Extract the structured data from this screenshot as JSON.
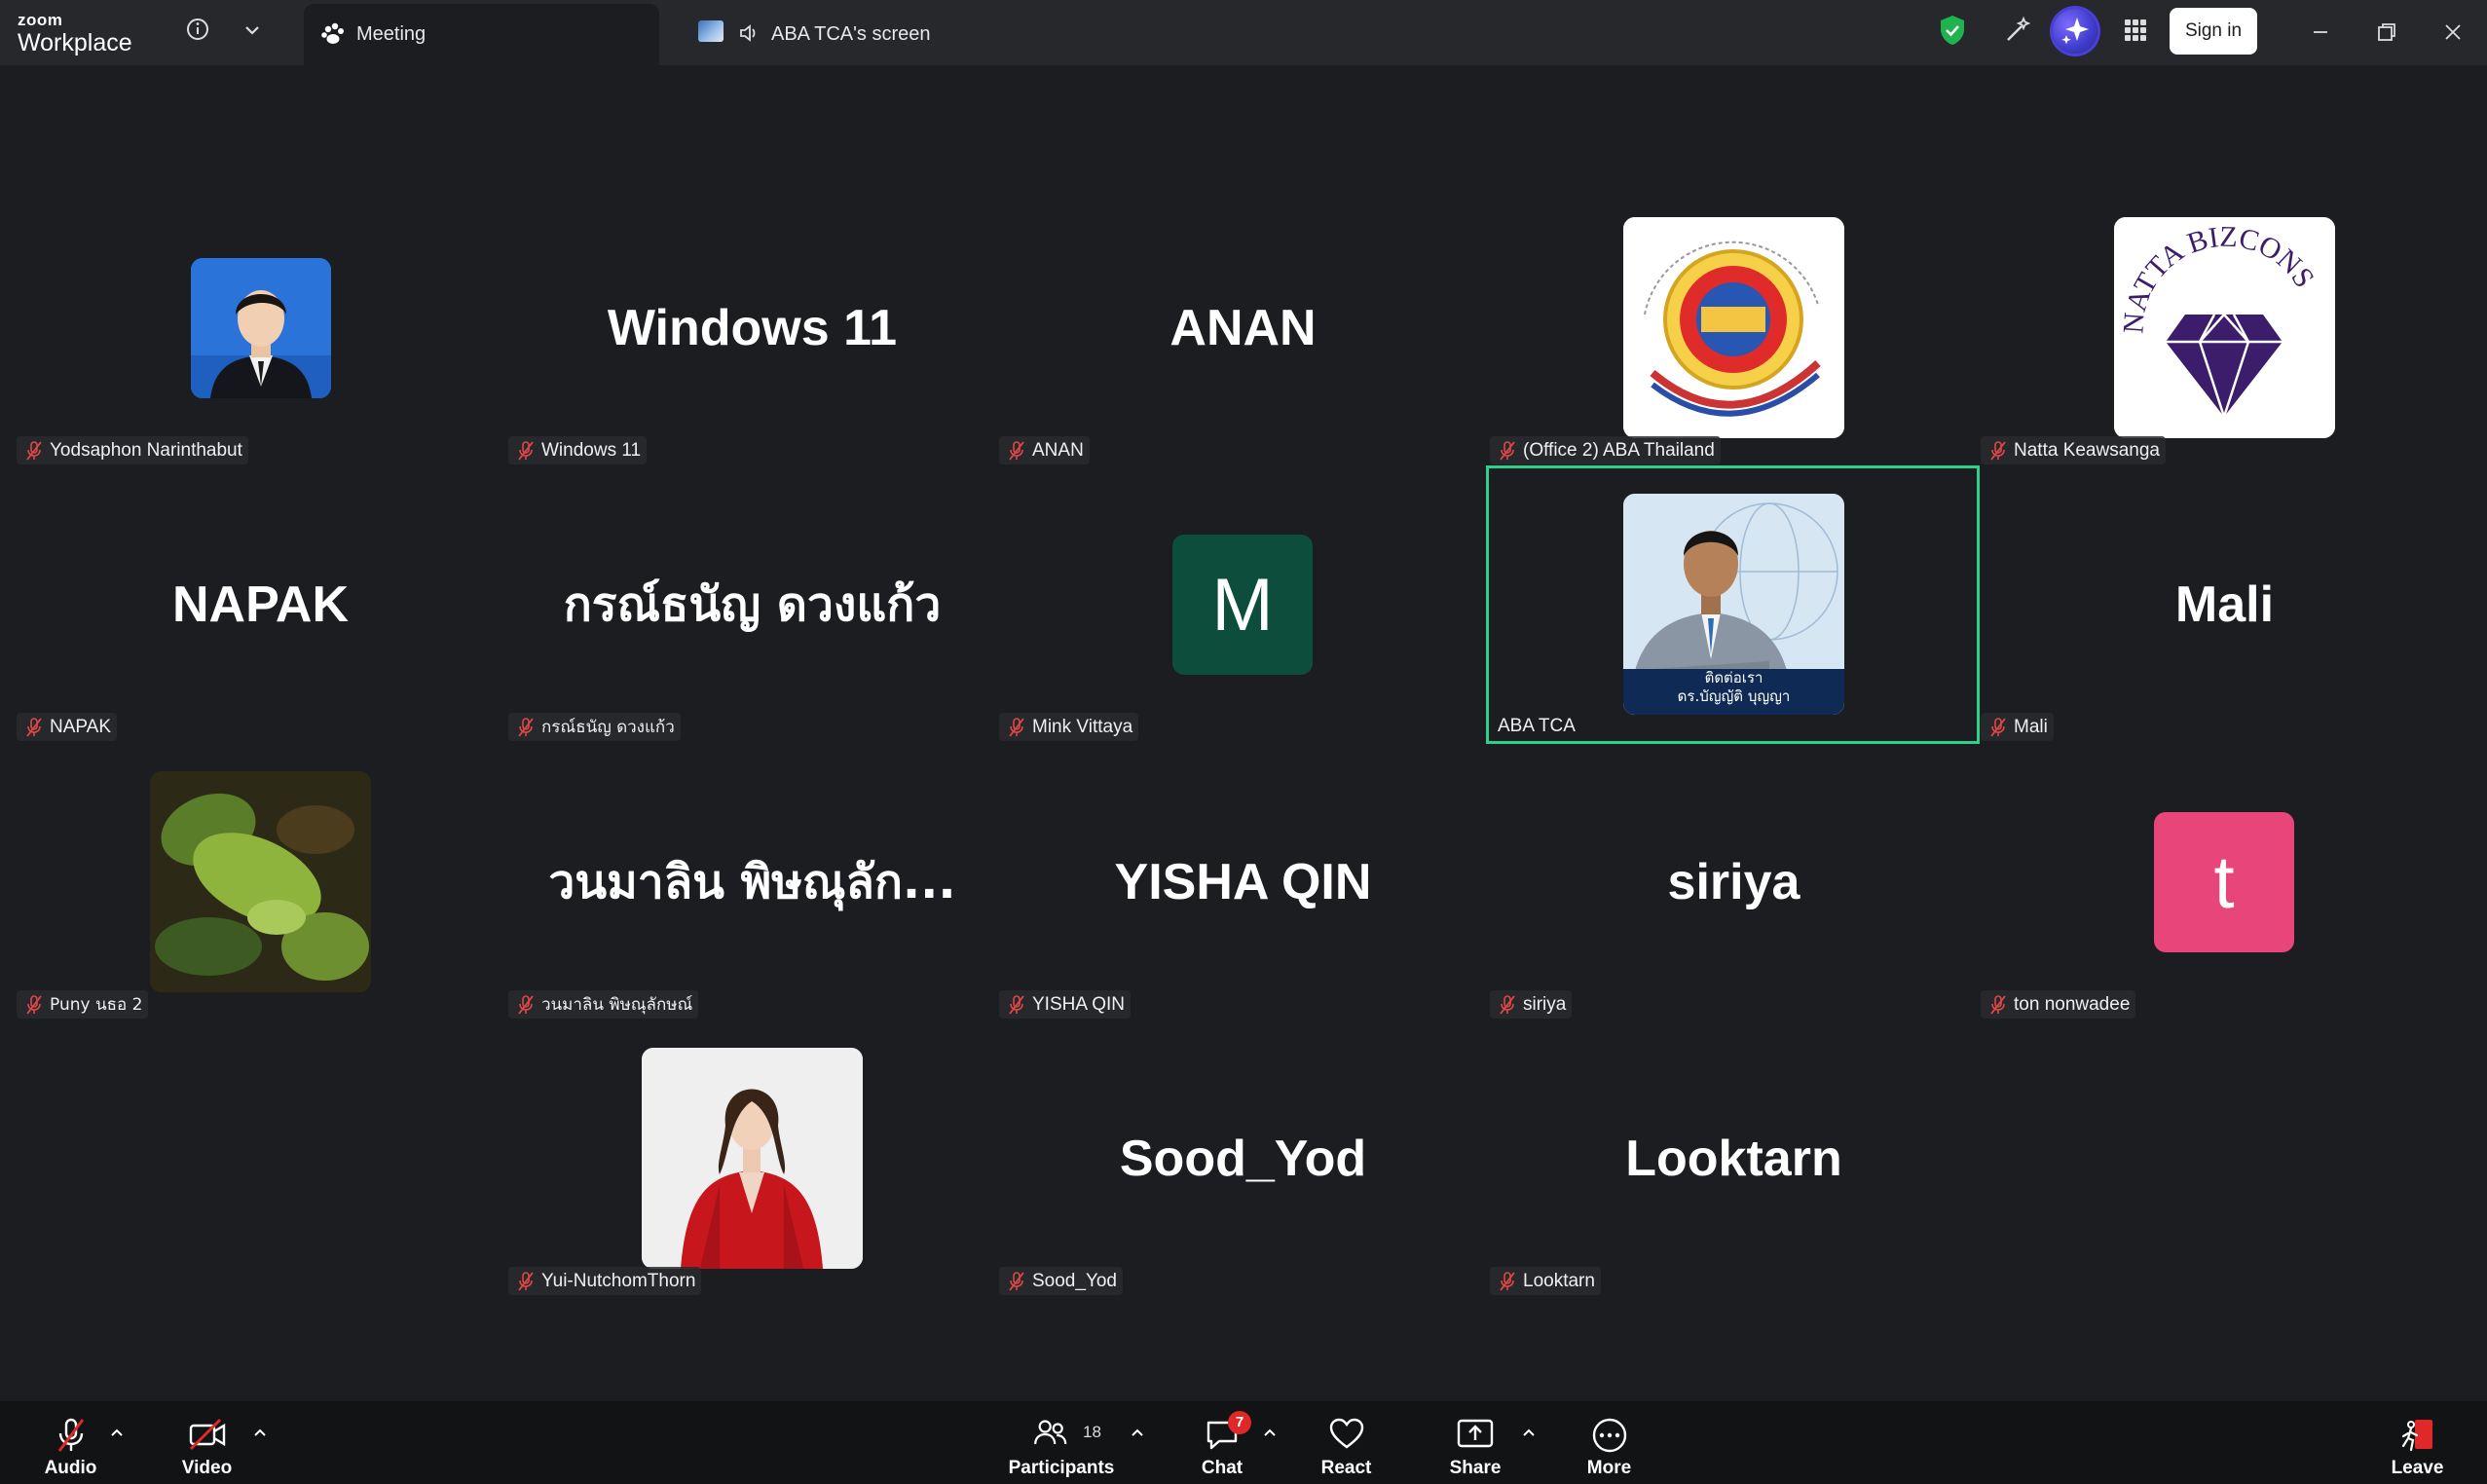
{
  "app": {
    "logo_top": "zoom",
    "logo_bottom": "Workplace"
  },
  "tabs": [
    {
      "label": "Meeting",
      "icon": "meeting-paw-icon",
      "active": true
    },
    {
      "label": "ABA TCA's screen",
      "icon": "speaker-icon",
      "active": false
    }
  ],
  "header": {
    "sign_in": "Sign in"
  },
  "colors": {
    "active_border": "#2fd08b",
    "mic_muted": "#e04848",
    "avatar_m": "#0d4d3c",
    "avatar_t": "#e8457a"
  },
  "participants": [
    {
      "name": "Yodsaphon Narinthabut",
      "display": "",
      "avatar": "photo-man-suit",
      "muted": true
    },
    {
      "name": "Windows 11",
      "display": "Windows 11",
      "avatar": "",
      "muted": true
    },
    {
      "name": "ANAN",
      "display": "ANAN",
      "avatar": "",
      "muted": true
    },
    {
      "name": "(Office 2) ABA Thailand",
      "display": "",
      "avatar": "aba-logo",
      "muted": true
    },
    {
      "name": "Natta Keawsanga",
      "display": "",
      "avatar": "natta-bizcons-logo",
      "logo_text": "NATTA BIZCONS",
      "muted": true
    },
    {
      "name": "NAPAK",
      "display": "NAPAK",
      "avatar": "",
      "muted": true
    },
    {
      "name": "กรณ์ธนัญ ดวงแก้ว",
      "display": "กรณ์ธนัญ ดวงแก้ว",
      "avatar": "",
      "muted": true
    },
    {
      "name": "Mink Vittaya",
      "display": "",
      "avatar": "letter",
      "letter": "M",
      "muted": true
    },
    {
      "name": "ABA TCA",
      "display": "",
      "avatar": "photo-speaker",
      "caption1": "ติดต่อเรา",
      "caption2": "ดร.บัญญัติ บุญญา",
      "muted": false,
      "active": true
    },
    {
      "name": "Mali",
      "display": "Mali",
      "avatar": "",
      "muted": true
    },
    {
      "name": "Puny นธอ 2",
      "display": "",
      "avatar": "photo-leaves",
      "muted": true
    },
    {
      "name": "วนมาลิน พิษณุลักษณ์",
      "display": "วนมาลิน  พิษณุลัก...",
      "avatar": "",
      "muted": true
    },
    {
      "name": "YISHA QIN",
      "display": "YISHA QIN",
      "avatar": "",
      "muted": true
    },
    {
      "name": "siriya",
      "display": "siriya",
      "avatar": "",
      "muted": true
    },
    {
      "name": "ton nonwadee",
      "display": "",
      "avatar": "letter",
      "letter": "t",
      "muted": true
    },
    {
      "name": "Yui-NutchomThorn",
      "display": "",
      "avatar": "photo-woman-red",
      "muted": true
    },
    {
      "name": "Sood_Yod",
      "display": "Sood_Yod",
      "avatar": "",
      "muted": true
    },
    {
      "name": "Looktarn",
      "display": "Looktarn",
      "avatar": "",
      "muted": true
    }
  ],
  "toolbar": {
    "audio": "Audio",
    "video": "Video",
    "participants": "Participants",
    "participants_count": "18",
    "chat": "Chat",
    "chat_badge": "7",
    "react": "React",
    "share": "Share",
    "more": "More",
    "leave": "Leave"
  }
}
